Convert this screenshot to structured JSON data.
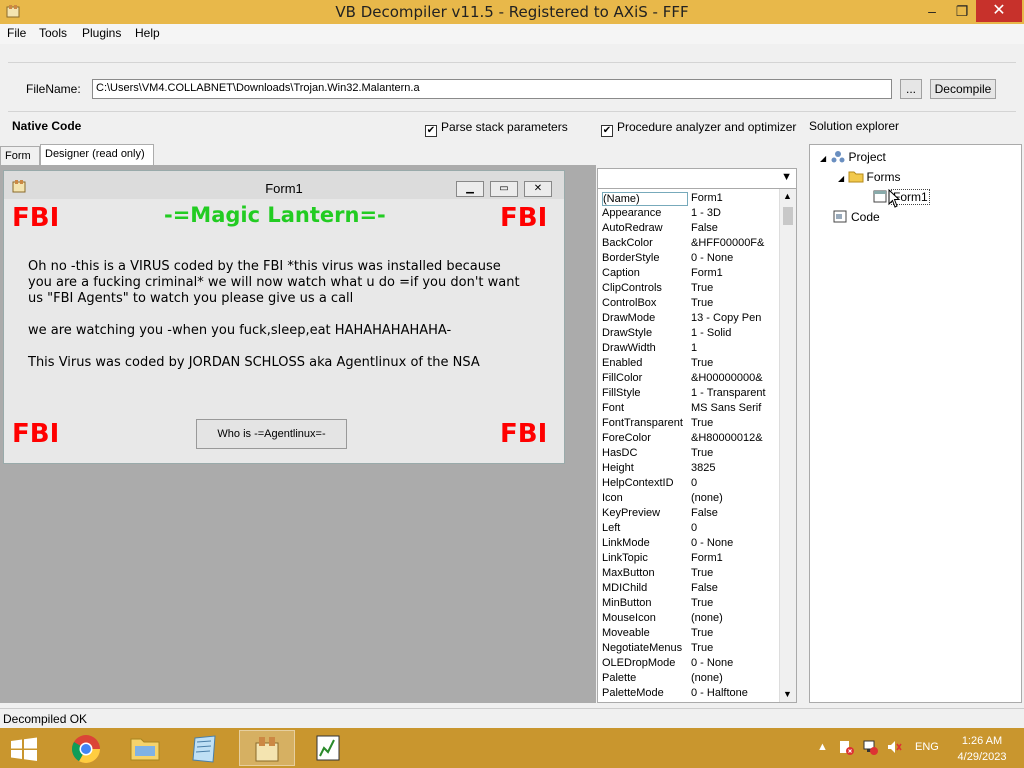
{
  "window": {
    "title": "VB Decompiler v11.5 - Registered to AXiS - FFF",
    "min": "–",
    "restore": "❐",
    "close": "✕"
  },
  "menu": [
    "File",
    "Tools",
    "Plugins",
    "Help"
  ],
  "file": {
    "label": "FileName:",
    "value": "C:\\Users\\VM4.COLLABNET\\Downloads\\Trojan.Win32.Malantern.a",
    "browse": "...",
    "decompile": "Decompile"
  },
  "options": {
    "native_code": "Native Code",
    "parse_stack": "Parse stack parameters",
    "procedure_analyzer": "Procedure analyzer and optimizer",
    "check": "✔",
    "solution_explorer": "Solution explorer"
  },
  "tabs": [
    "Form",
    "Designer (read only)"
  ],
  "form": {
    "title": "Form1",
    "fbi": "FBI",
    "heading": "-=Magic Lantern=-",
    "lines": [
      "Oh no -this is a VIRUS coded by the FBI  *this virus was installed because",
      "you are a fucking criminal* we will now watch what u do =if you don't want",
      "us \"FBI Agents\" to watch you please give us a call"
    ],
    "line2": "we are watching you -when you fuck,sleep,eat  HAHAHAHAHAHA-",
    "line3": "This Virus was coded by JORDAN SCHLOSS aka Agentlinux  of the NSA",
    "button": "Who is -=Agentlinux=-"
  },
  "properties": [
    [
      "(Name)",
      "Form1"
    ],
    [
      "Appearance",
      "1 - 3D"
    ],
    [
      "AutoRedraw",
      "False"
    ],
    [
      "BackColor",
      "&HFF00000F&"
    ],
    [
      "BorderStyle",
      "0 - None"
    ],
    [
      "Caption",
      "Form1"
    ],
    [
      "ClipControls",
      "True"
    ],
    [
      "ControlBox",
      "True"
    ],
    [
      "DrawMode",
      "13 - Copy Pen"
    ],
    [
      "DrawStyle",
      "1 - Solid"
    ],
    [
      "DrawWidth",
      "1"
    ],
    [
      "Enabled",
      "True"
    ],
    [
      "FillColor",
      "&H00000000&"
    ],
    [
      "FillStyle",
      "1 - Transparent"
    ],
    [
      "Font",
      "MS Sans Serif"
    ],
    [
      "FontTransparent",
      "True"
    ],
    [
      "ForeColor",
      "&H80000012&"
    ],
    [
      "HasDC",
      "True"
    ],
    [
      "Height",
      "3825"
    ],
    [
      "HelpContextID",
      "0"
    ],
    [
      "Icon",
      "(none)"
    ],
    [
      "KeyPreview",
      "False"
    ],
    [
      "Left",
      "0"
    ],
    [
      "LinkMode",
      "0 - None"
    ],
    [
      "LinkTopic",
      "Form1"
    ],
    [
      "MaxButton",
      "True"
    ],
    [
      "MDIChild",
      "False"
    ],
    [
      "MinButton",
      "True"
    ],
    [
      "MouseIcon",
      "(none)"
    ],
    [
      "Moveable",
      "True"
    ],
    [
      "NegotiateMenus",
      "True"
    ],
    [
      "OLEDropMode",
      "0 - None"
    ],
    [
      "Palette",
      "(none)"
    ],
    [
      "PaletteMode",
      "0 - Halftone"
    ]
  ],
  "tree": {
    "project": "Project",
    "forms": "Forms",
    "form1": "Form1",
    "code": "Code"
  },
  "status": "Decompiled OK",
  "tray": {
    "lang": "ENG",
    "time": "1:26 AM",
    "date": "4/29/2023"
  },
  "colors": {
    "titlebar": "#e8b84a",
    "taskbar": "#c9962e",
    "fbi": "#ff0000",
    "magic": "#22cc22"
  }
}
